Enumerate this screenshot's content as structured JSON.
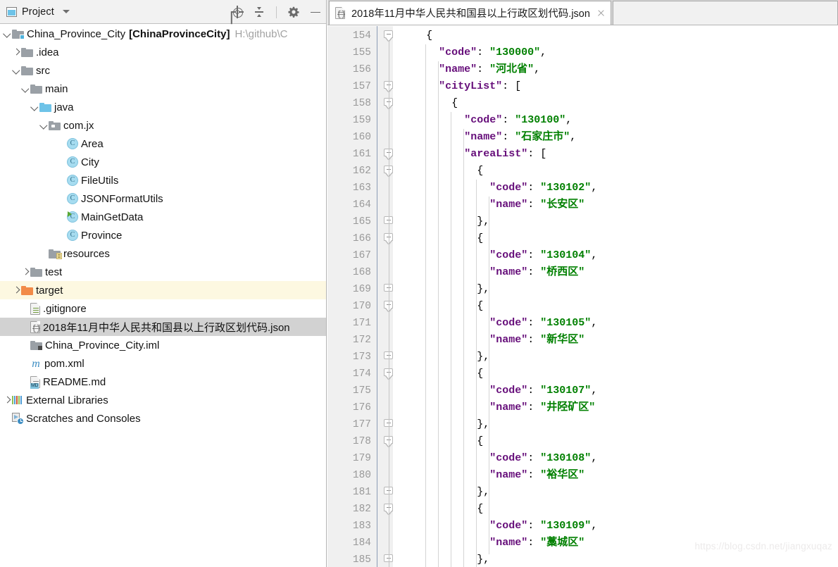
{
  "project_panel": {
    "title": "Project",
    "window_icon": "project-window-icon",
    "dropdown_icon": "chevron-down-icon",
    "tools": [
      {
        "name": "locate-icon",
        "title": "Select Opened File"
      },
      {
        "name": "collapse-all-icon",
        "title": "Collapse All"
      },
      {
        "name": "gear-icon",
        "title": "Settings"
      },
      {
        "name": "minimize-icon",
        "title": "Hide"
      }
    ],
    "tree": [
      {
        "label": "China_Province_City",
        "bold_label": "[ChinaProvinceCity]",
        "path": "H:\\github\\C",
        "arrow": "down",
        "icon": "module-folder-icon",
        "indent": 0
      },
      {
        "label": ".idea",
        "arrow": "right",
        "icon": "folder-gray-icon",
        "indent": 1
      },
      {
        "label": "src",
        "arrow": "down",
        "icon": "folder-gray-icon",
        "indent": 1
      },
      {
        "label": "main",
        "arrow": "down",
        "icon": "folder-gray-icon",
        "indent": 2
      },
      {
        "label": "java",
        "arrow": "down",
        "icon": "folder-source-blue-icon",
        "indent": 3
      },
      {
        "label": "com.jx",
        "arrow": "down",
        "icon": "package-icon",
        "indent": 4
      },
      {
        "label": "Area",
        "arrow": "none",
        "icon": "java-class-icon",
        "indent": 6
      },
      {
        "label": "City",
        "arrow": "none",
        "icon": "java-class-icon",
        "indent": 6
      },
      {
        "label": "FileUtils",
        "arrow": "none",
        "icon": "java-class-icon",
        "indent": 6
      },
      {
        "label": "JSONFormatUtils",
        "arrow": "none",
        "icon": "java-class-icon",
        "indent": 6
      },
      {
        "label": "MainGetData",
        "arrow": "none",
        "icon": "java-class-runnable-icon",
        "indent": 6
      },
      {
        "label": "Province",
        "arrow": "none",
        "icon": "java-class-icon",
        "indent": 6
      },
      {
        "label": "resources",
        "arrow": "none",
        "icon": "folder-resources-icon",
        "indent": 4
      },
      {
        "label": "test",
        "arrow": "right",
        "icon": "folder-gray-icon",
        "indent": 2
      },
      {
        "label": "target",
        "arrow": "right",
        "icon": "folder-excluded-orange-icon",
        "indent": 1,
        "state": "highlighted"
      },
      {
        "label": ".gitignore",
        "arrow": "none",
        "icon": "gitignore-file-icon",
        "indent": 2
      },
      {
        "label": "2018年11月中华人民共和国县以上行政区划代码.json",
        "arrow": "none",
        "icon": "json-file-icon",
        "indent": 2,
        "state": "selected"
      },
      {
        "label": "China_Province_City.iml",
        "arrow": "none",
        "icon": "iml-file-icon",
        "indent": 2
      },
      {
        "label": "pom.xml",
        "arrow": "none",
        "icon": "maven-pom-icon",
        "indent": 2
      },
      {
        "label": "README.md",
        "arrow": "none",
        "icon": "markdown-file-icon",
        "indent": 2
      },
      {
        "label": "External Libraries",
        "arrow": "right",
        "icon": "external-libraries-icon",
        "indent": 0
      },
      {
        "label": "Scratches and Consoles",
        "arrow": "none",
        "icon": "scratches-icon",
        "indent": 0
      }
    ]
  },
  "editor": {
    "tab": {
      "title": "2018年11月中华人民共和国县以上行政区划代码.json",
      "icon": "json-file-icon",
      "close_icon": "close-icon"
    },
    "first_line_number": 154,
    "last_line_number": 185,
    "lines": [
      {
        "n": 154,
        "indent": 4,
        "fold": "start",
        "tokens": [
          {
            "t": "{",
            "c": "p"
          }
        ]
      },
      {
        "n": 155,
        "indent": 6,
        "fold": "none",
        "tokens": [
          {
            "t": "\"code\"",
            "c": "k"
          },
          {
            "t": ": ",
            "c": "p"
          },
          {
            "t": "\"130000\"",
            "c": "s"
          },
          {
            "t": ",",
            "c": "p"
          }
        ]
      },
      {
        "n": 156,
        "indent": 6,
        "fold": "none",
        "tokens": [
          {
            "t": "\"name\"",
            "c": "k"
          },
          {
            "t": ": ",
            "c": "p"
          },
          {
            "t": "\"河北省\"",
            "c": "s"
          },
          {
            "t": ",",
            "c": "p"
          }
        ]
      },
      {
        "n": 157,
        "indent": 6,
        "fold": "start",
        "tokens": [
          {
            "t": "\"cityList\"",
            "c": "k"
          },
          {
            "t": ": [",
            "c": "p"
          }
        ]
      },
      {
        "n": 158,
        "indent": 8,
        "fold": "start",
        "tokens": [
          {
            "t": "{",
            "c": "p"
          }
        ]
      },
      {
        "n": 159,
        "indent": 10,
        "fold": "none",
        "tokens": [
          {
            "t": "\"code\"",
            "c": "k"
          },
          {
            "t": ": ",
            "c": "p"
          },
          {
            "t": "\"130100\"",
            "c": "s"
          },
          {
            "t": ",",
            "c": "p"
          }
        ]
      },
      {
        "n": 160,
        "indent": 10,
        "fold": "none",
        "tokens": [
          {
            "t": "\"name\"",
            "c": "k"
          },
          {
            "t": ": ",
            "c": "p"
          },
          {
            "t": "\"石家庄市\"",
            "c": "s"
          },
          {
            "t": ",",
            "c": "p"
          }
        ]
      },
      {
        "n": 161,
        "indent": 10,
        "fold": "start",
        "tokens": [
          {
            "t": "\"areaList\"",
            "c": "k"
          },
          {
            "t": ": [",
            "c": "p"
          }
        ]
      },
      {
        "n": 162,
        "indent": 12,
        "fold": "start",
        "tokens": [
          {
            "t": "{",
            "c": "p"
          }
        ]
      },
      {
        "n": 163,
        "indent": 14,
        "fold": "none",
        "tokens": [
          {
            "t": "\"code\"",
            "c": "k"
          },
          {
            "t": ": ",
            "c": "p"
          },
          {
            "t": "\"130102\"",
            "c": "s"
          },
          {
            "t": ",",
            "c": "p"
          }
        ]
      },
      {
        "n": 164,
        "indent": 14,
        "fold": "none",
        "tokens": [
          {
            "t": "\"name\"",
            "c": "k"
          },
          {
            "t": ": ",
            "c": "p"
          },
          {
            "t": "\"长安区\"",
            "c": "s"
          }
        ]
      },
      {
        "n": 165,
        "indent": 12,
        "fold": "end",
        "tokens": [
          {
            "t": "},",
            "c": "p"
          }
        ]
      },
      {
        "n": 166,
        "indent": 12,
        "fold": "start",
        "tokens": [
          {
            "t": "{",
            "c": "p"
          }
        ]
      },
      {
        "n": 167,
        "indent": 14,
        "fold": "none",
        "tokens": [
          {
            "t": "\"code\"",
            "c": "k"
          },
          {
            "t": ": ",
            "c": "p"
          },
          {
            "t": "\"130104\"",
            "c": "s"
          },
          {
            "t": ",",
            "c": "p"
          }
        ]
      },
      {
        "n": 168,
        "indent": 14,
        "fold": "none",
        "tokens": [
          {
            "t": "\"name\"",
            "c": "k"
          },
          {
            "t": ": ",
            "c": "p"
          },
          {
            "t": "\"桥西区\"",
            "c": "s"
          }
        ]
      },
      {
        "n": 169,
        "indent": 12,
        "fold": "end",
        "tokens": [
          {
            "t": "},",
            "c": "p"
          }
        ]
      },
      {
        "n": 170,
        "indent": 12,
        "fold": "start",
        "tokens": [
          {
            "t": "{",
            "c": "p"
          }
        ]
      },
      {
        "n": 171,
        "indent": 14,
        "fold": "none",
        "tokens": [
          {
            "t": "\"code\"",
            "c": "k"
          },
          {
            "t": ": ",
            "c": "p"
          },
          {
            "t": "\"130105\"",
            "c": "s"
          },
          {
            "t": ",",
            "c": "p"
          }
        ]
      },
      {
        "n": 172,
        "indent": 14,
        "fold": "none",
        "tokens": [
          {
            "t": "\"name\"",
            "c": "k"
          },
          {
            "t": ": ",
            "c": "p"
          },
          {
            "t": "\"新华区\"",
            "c": "s"
          }
        ]
      },
      {
        "n": 173,
        "indent": 12,
        "fold": "end",
        "tokens": [
          {
            "t": "},",
            "c": "p"
          }
        ]
      },
      {
        "n": 174,
        "indent": 12,
        "fold": "start",
        "tokens": [
          {
            "t": "{",
            "c": "p"
          }
        ]
      },
      {
        "n": 175,
        "indent": 14,
        "fold": "none",
        "tokens": [
          {
            "t": "\"code\"",
            "c": "k"
          },
          {
            "t": ": ",
            "c": "p"
          },
          {
            "t": "\"130107\"",
            "c": "s"
          },
          {
            "t": ",",
            "c": "p"
          }
        ]
      },
      {
        "n": 176,
        "indent": 14,
        "fold": "none",
        "tokens": [
          {
            "t": "\"name\"",
            "c": "k"
          },
          {
            "t": ": ",
            "c": "p"
          },
          {
            "t": "\"井陉矿区\"",
            "c": "s"
          }
        ]
      },
      {
        "n": 177,
        "indent": 12,
        "fold": "end",
        "tokens": [
          {
            "t": "},",
            "c": "p"
          }
        ]
      },
      {
        "n": 178,
        "indent": 12,
        "fold": "start",
        "tokens": [
          {
            "t": "{",
            "c": "p"
          }
        ]
      },
      {
        "n": 179,
        "indent": 14,
        "fold": "none",
        "tokens": [
          {
            "t": "\"code\"",
            "c": "k"
          },
          {
            "t": ": ",
            "c": "p"
          },
          {
            "t": "\"130108\"",
            "c": "s"
          },
          {
            "t": ",",
            "c": "p"
          }
        ]
      },
      {
        "n": 180,
        "indent": 14,
        "fold": "none",
        "tokens": [
          {
            "t": "\"name\"",
            "c": "k"
          },
          {
            "t": ": ",
            "c": "p"
          },
          {
            "t": "\"裕华区\"",
            "c": "s"
          }
        ]
      },
      {
        "n": 181,
        "indent": 12,
        "fold": "end",
        "tokens": [
          {
            "t": "},",
            "c": "p"
          }
        ]
      },
      {
        "n": 182,
        "indent": 12,
        "fold": "start",
        "tokens": [
          {
            "t": "{",
            "c": "p"
          }
        ]
      },
      {
        "n": 183,
        "indent": 14,
        "fold": "none",
        "tokens": [
          {
            "t": "\"code\"",
            "c": "k"
          },
          {
            "t": ": ",
            "c": "p"
          },
          {
            "t": "\"130109\"",
            "c": "s"
          },
          {
            "t": ",",
            "c": "p"
          }
        ]
      },
      {
        "n": 184,
        "indent": 14,
        "fold": "none",
        "tokens": [
          {
            "t": "\"name\"",
            "c": "k"
          },
          {
            "t": ": ",
            "c": "p"
          },
          {
            "t": "\"藁城区\"",
            "c": "s"
          }
        ]
      },
      {
        "n": 185,
        "indent": 12,
        "fold": "end",
        "tokens": [
          {
            "t": "},",
            "c": "p"
          }
        ]
      }
    ]
  },
  "watermark": "https://blog.csdn.net/jiangxuqaz",
  "colors": {
    "json_key": "#660e7a",
    "json_string": "#008000",
    "selection_gray": "#d2d2d2",
    "highlight_yellow": "#fdf8e1",
    "gutter_bg": "#f0f0f0",
    "tabbar_bg": "#d6d6d6"
  }
}
